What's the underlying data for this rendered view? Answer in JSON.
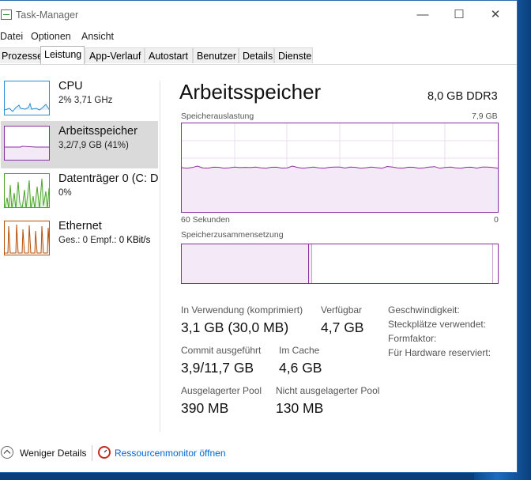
{
  "window": {
    "title": "Task-Manager"
  },
  "titlebar_buttons": {
    "minimize": "—",
    "maximize": "☐",
    "close": "✕"
  },
  "menu": [
    "Datei",
    "Optionen",
    "Ansicht"
  ],
  "tabs": [
    {
      "label": "Prozesse"
    },
    {
      "label": "Leistung",
      "active": true
    },
    {
      "label": "App-Verlauf"
    },
    {
      "label": "Autostart"
    },
    {
      "label": "Benutzer"
    },
    {
      "label": "Details"
    },
    {
      "label": "Dienste"
    }
  ],
  "sidebar": {
    "items": [
      {
        "title": "CPU",
        "sub": "2% 3,71 GHz",
        "color": "#2b8fd1"
      },
      {
        "title": "Arbeitsspeicher",
        "sub": "3,2/7,9 GB (41%)",
        "color": "#8b2fa0",
        "selected": true
      },
      {
        "title": "Datenträger 0 (C: D",
        "sub": "0%",
        "color": "#4aa529"
      },
      {
        "title": "Ethernet",
        "sub_parts": [
          "Ges.: 0 Empf.: ",
          "0 KBit/s"
        ],
        "color": "#b5510b"
      }
    ]
  },
  "main": {
    "title": "Arbeitsspeicher",
    "spec": "8,0 GB DDR3",
    "usage_label": "Speicherauslastung",
    "usage_max": "7,9 GB",
    "time_left": "60 Sekunden",
    "time_right": "0",
    "composition_label": "Speicherzusammensetzung",
    "usage_level": 0.41,
    "composition_split": 0.4,
    "stats": {
      "in_use_label": "In Verwendung (komprimiert)",
      "in_use_value": "3,1 GB (30,0 MB)",
      "available_label": "Verfügbar",
      "available_value": "4,7 GB",
      "commit_label": "Commit ausgeführt",
      "commit_value": "3,9/11,7 GB",
      "cached_label": "Im Cache",
      "cached_value": "4,6 GB",
      "paged_label": "Ausgelagerter Pool",
      "paged_value": "390 MB",
      "nonpaged_label": "Nicht ausgelagerter Pool",
      "nonpaged_value": "130 MB"
    },
    "details": {
      "speed": "Geschwindigkeit:",
      "slots": "Steckplätze verwendet:",
      "form": "Formfaktor:",
      "reserved": "Für Hardware reserviert:"
    }
  },
  "footer": {
    "fewer_details": "Weniger Details",
    "resource_monitor": "Ressourcenmonitor öffnen"
  },
  "colors": {
    "memory": "#8b2fa0",
    "link": "#0066cc"
  }
}
